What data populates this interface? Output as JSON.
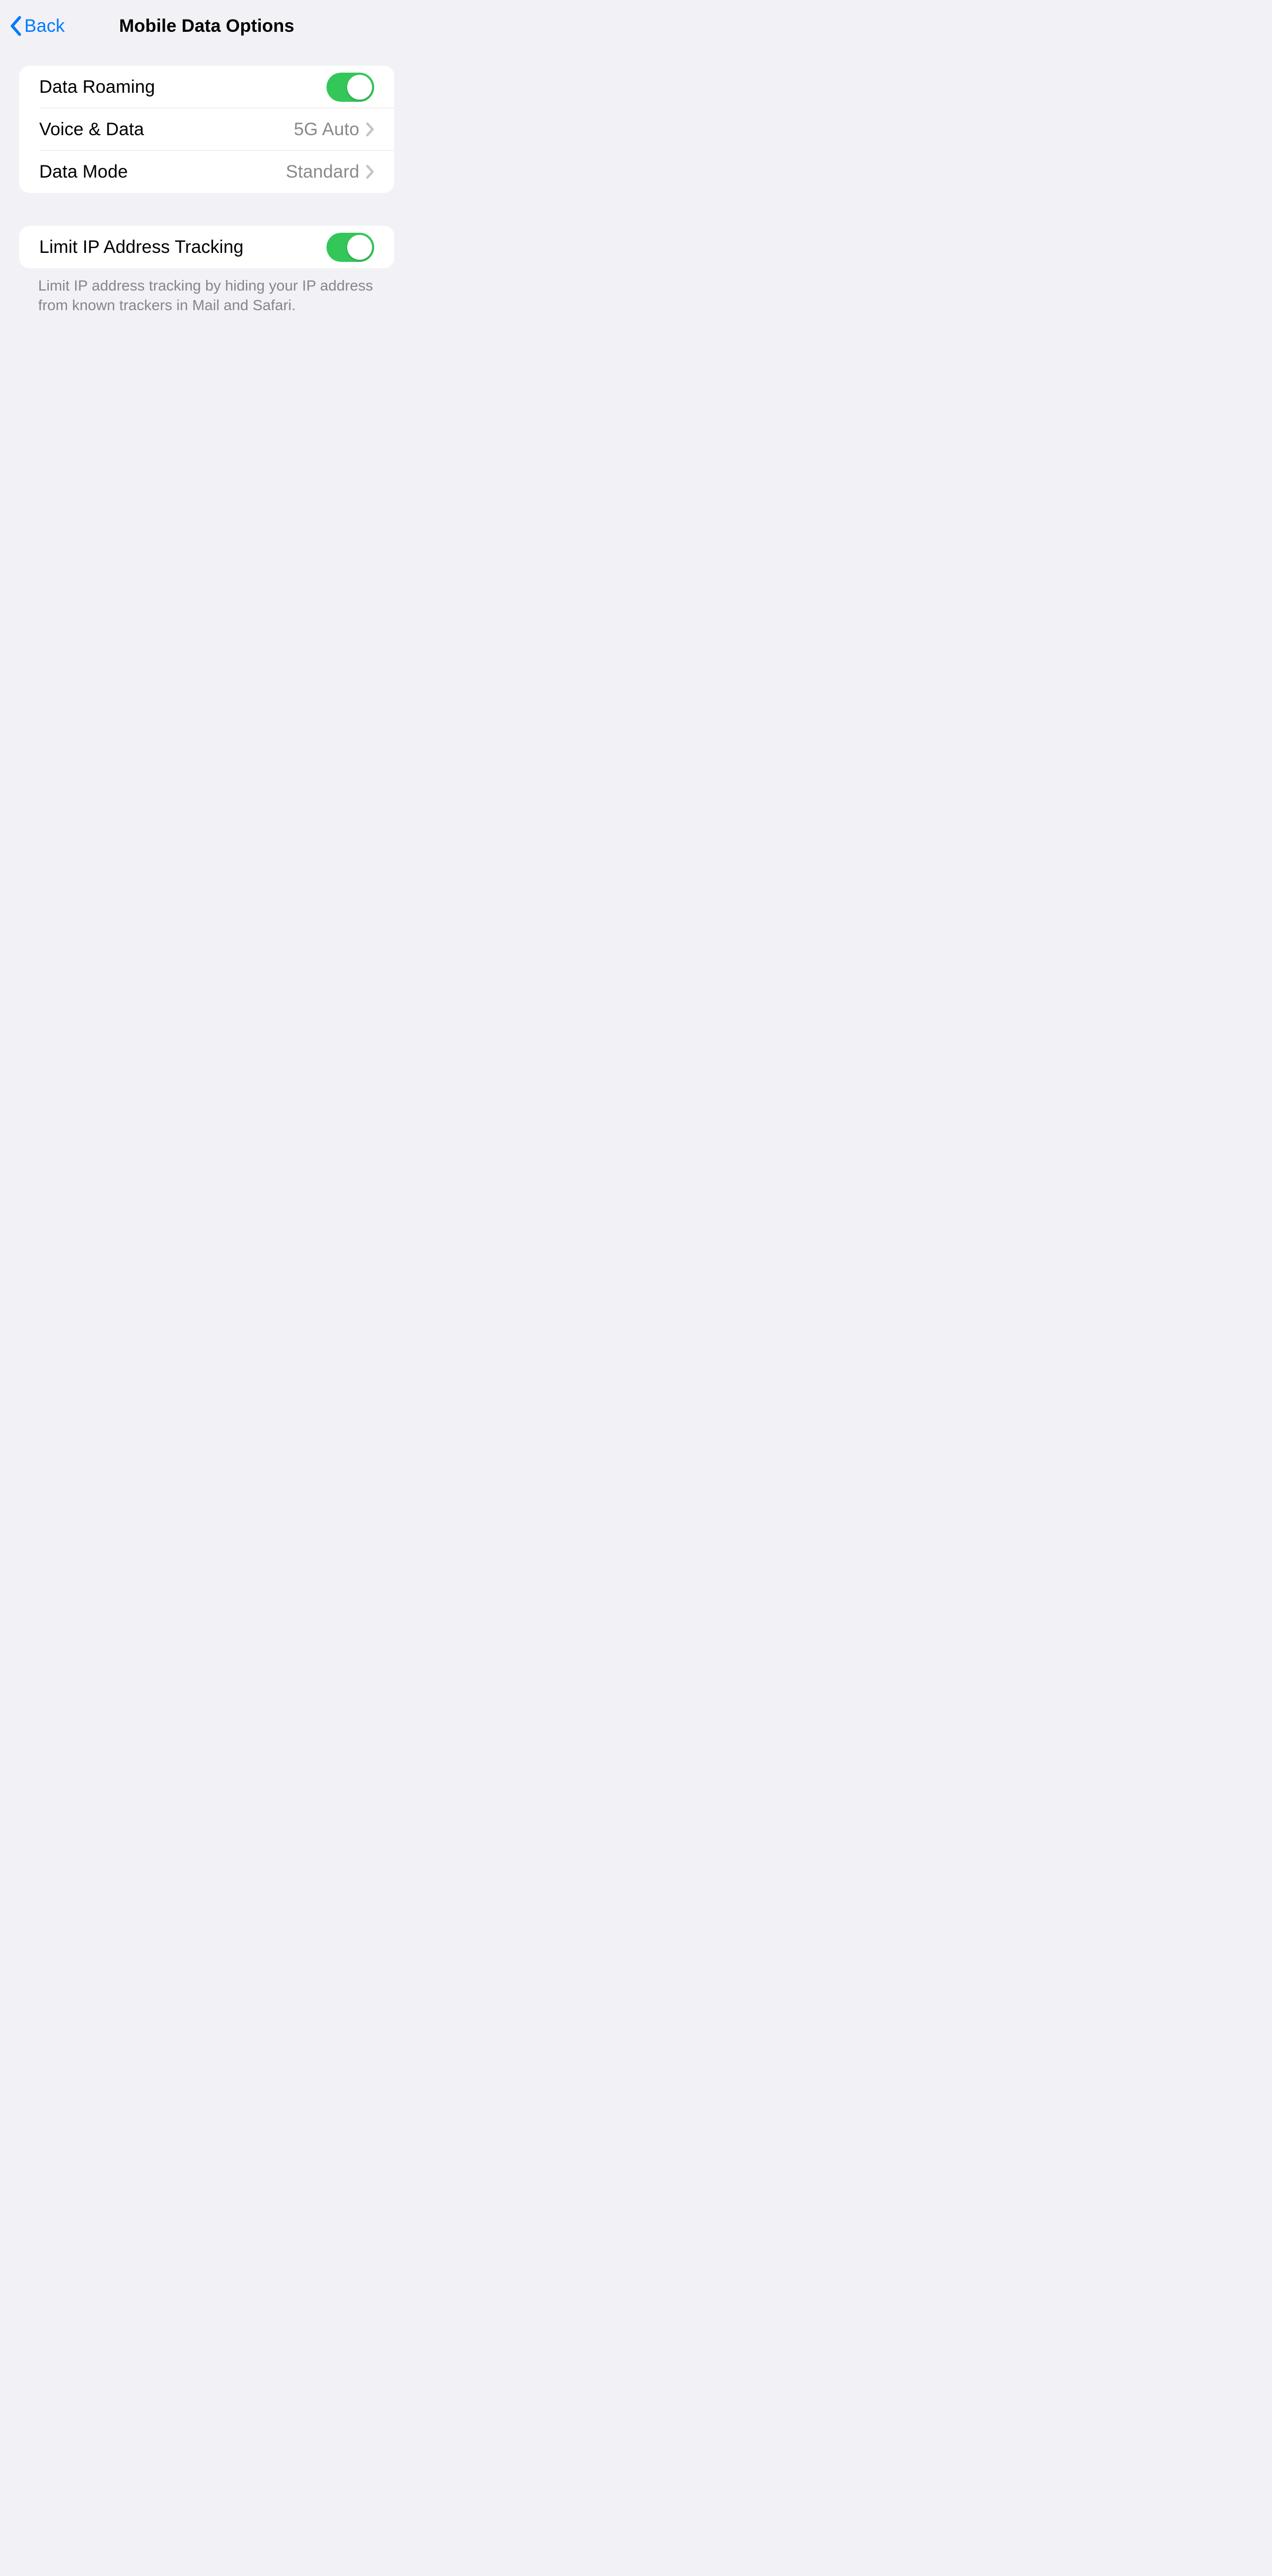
{
  "header": {
    "back_label": "Back",
    "title": "Mobile Data Options"
  },
  "section1": {
    "rows": [
      {
        "label": "Data Roaming",
        "type": "toggle",
        "on": true
      },
      {
        "label": "Voice & Data",
        "type": "nav",
        "value": "5G Auto"
      },
      {
        "label": "Data Mode",
        "type": "nav",
        "value": "Standard"
      }
    ]
  },
  "section2": {
    "rows": [
      {
        "label": "Limit IP Address Tracking",
        "type": "toggle",
        "on": true
      }
    ],
    "footer": "Limit IP address tracking by hiding your IP address from known trackers in Mail and Safari."
  }
}
